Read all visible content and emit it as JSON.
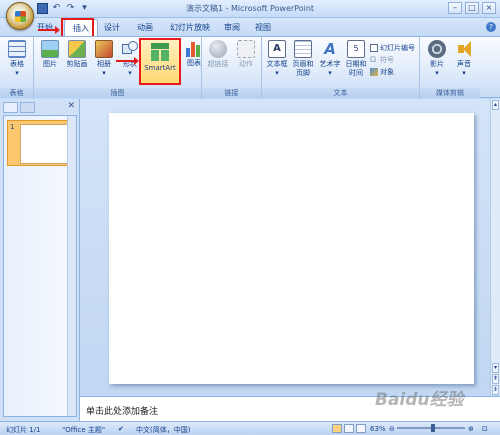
{
  "window": {
    "title": "演示文稿1 - Microsoft PowerPoint",
    "controls": [
      "–",
      "□",
      "×"
    ]
  },
  "qat": {
    "undo": "↶",
    "redo": "↷",
    "dropdown": "▾"
  },
  "tabs": [
    {
      "label": "开始",
      "active": false
    },
    {
      "label": "插入",
      "active": true
    },
    {
      "label": "设计",
      "active": false
    },
    {
      "label": "动画",
      "active": false
    },
    {
      "label": "幻灯片放映",
      "active": false
    },
    {
      "label": "审阅",
      "active": false
    },
    {
      "label": "视图",
      "active": false
    }
  ],
  "ribbon": {
    "groups": {
      "tables": "表格",
      "illustrations": "插图",
      "links": "链接",
      "text": "文本",
      "media": "媒体剪辑"
    },
    "buttons": {
      "table": "表格",
      "picture": "图片",
      "clipart": "剪贴画",
      "album": "相册",
      "shapes": "形状",
      "smartart": "SmartArt",
      "chart": "图表",
      "hyperlink": "超链接",
      "action": "动作",
      "textbox": "文本框",
      "header_footer_1": "页眉和",
      "header_footer_2": "页脚",
      "wordart": "艺术字",
      "datetime_1": "日期和",
      "datetime_2": "时间",
      "slide_number": "幻灯片编号",
      "symbol": "符号",
      "object": "对象",
      "movie": "影片",
      "sound": "声音"
    }
  },
  "slides_pane": {
    "slide_number": "1"
  },
  "notes": {
    "placeholder": "单击此处添加备注"
  },
  "status": {
    "slide": "幻灯片 1/1",
    "theme": "\"Office 主题\"",
    "language": "中文(简体，中国)",
    "zoom": "63%",
    "zoom_level": 0.63
  },
  "watermark": "Baidu经验"
}
